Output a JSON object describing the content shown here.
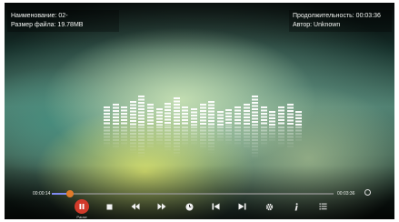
{
  "info": {
    "name": "Наименование: 02-",
    "size": "Размер файла: 19.78MB",
    "duration": "Продолжительность: 00:03:36",
    "author": "Автор: Unknown"
  },
  "playback": {
    "current_time": "00:00:14",
    "total_time": "00:03:36",
    "progress": 0.065
  },
  "controls": {
    "pause_label": "Pause",
    "icons": [
      "pause-icon",
      "stop-icon",
      "rewind-icon",
      "fast-forward-icon",
      "clock-icon",
      "previous-track-icon",
      "next-track-icon",
      "settings-icon",
      "info-icon",
      "playlist-icon",
      "repeat-icon"
    ]
  },
  "colors": {
    "accent_pause": "#d13a2a",
    "progress_knob": "#e07a2a",
    "progress_fill": "#7f8af0"
  }
}
